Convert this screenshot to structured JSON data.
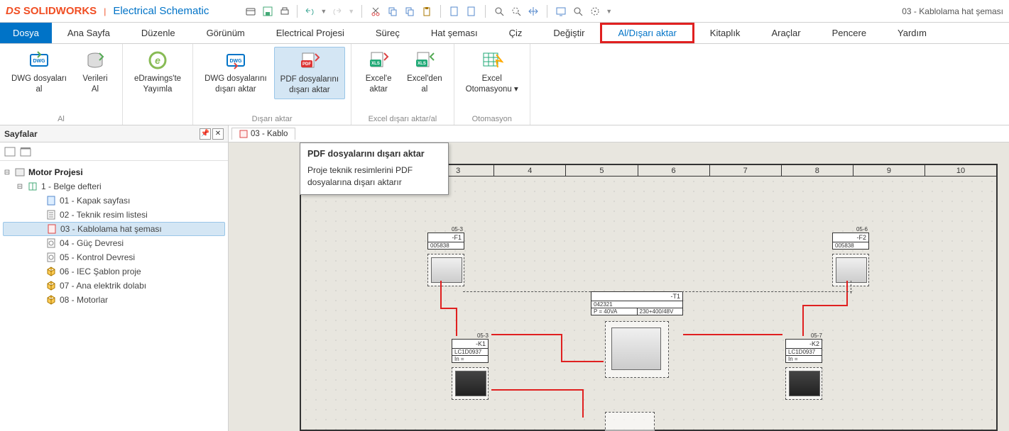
{
  "app": {
    "logo_ds": "DS",
    "logo_sw": "SOLIDWORKS",
    "logo_sub": "Electrical Schematic",
    "document_title": "03 - Kablolama hat şeması"
  },
  "menubar": [
    {
      "label": "Dosya",
      "file": true
    },
    {
      "label": "Ana Sayfa"
    },
    {
      "label": "Düzenle"
    },
    {
      "label": "Görünüm"
    },
    {
      "label": "Electrical Projesi"
    },
    {
      "label": "Süreç"
    },
    {
      "label": "Hat şeması"
    },
    {
      "label": "Çiz"
    },
    {
      "label": "Değiştir"
    },
    {
      "label": "Al/Dışarı aktar",
      "highlighted": true
    },
    {
      "label": "Kitaplık"
    },
    {
      "label": "Araçlar"
    },
    {
      "label": "Pencere"
    },
    {
      "label": "Yardım"
    }
  ],
  "ribbon": {
    "groups": [
      {
        "label": "Al",
        "buttons": [
          {
            "label": "DWG dosyaları\nal",
            "icon": "dwg"
          },
          {
            "label": "Verileri\nAl",
            "icon": "db"
          }
        ]
      },
      {
        "label": "",
        "buttons": [
          {
            "label": "eDrawings'te\nYayımla",
            "icon": "edrawings"
          }
        ]
      },
      {
        "label": "Dışarı aktar",
        "buttons": [
          {
            "label": "DWG dosyalarını\ndışarı aktar",
            "icon": "dwg"
          },
          {
            "label": "PDF dosyalarını\ndışarı aktar",
            "icon": "pdf",
            "active": true
          }
        ]
      },
      {
        "label": "Excel dışarı aktar/al",
        "buttons": [
          {
            "label": "Excel'e\naktar",
            "icon": "xls"
          },
          {
            "label": "Excel'den\nal",
            "icon": "xls"
          }
        ]
      },
      {
        "label": "Otomasyon",
        "buttons": [
          {
            "label": "Excel\nOtomasyonu ▾",
            "icon": "xls-auto"
          }
        ]
      }
    ]
  },
  "tooltip": {
    "title": "PDF dosyalarını dışarı aktar",
    "body": "Proje teknik resimlerini PDF dosyalarına dışarı aktarır"
  },
  "sidebar": {
    "title": "Sayfalar",
    "tree": {
      "root": "Motor Projesi",
      "book": "1 - Belge defteri",
      "pages": [
        {
          "label": "01 - Kapak sayfası",
          "icon": "cover"
        },
        {
          "label": "02 - Teknik resim listesi",
          "icon": "list"
        },
        {
          "label": "03 - Kablolama hat şeması",
          "icon": "wiring",
          "selected": true
        },
        {
          "label": "04 - Güç Devresi",
          "icon": "scheme"
        },
        {
          "label": "05 - Kontrol Devresi",
          "icon": "scheme"
        },
        {
          "label": "06 - IEC Şablon proje",
          "icon": "cube"
        },
        {
          "label": "07 - Ana elektrik dolabı",
          "icon": "cube"
        },
        {
          "label": "08 - Motorlar",
          "icon": "cube"
        }
      ]
    }
  },
  "doc_tab": "03 - Kablo",
  "columns": [
    "3",
    "4",
    "5",
    "6",
    "7",
    "8",
    "9",
    "10"
  ],
  "schematic": {
    "F1": {
      "name": "-F1",
      "code": "005838",
      "ref": "05-3"
    },
    "F2": {
      "name": "-F2",
      "code": "005838",
      "ref": "05-6"
    },
    "K1": {
      "name": "-K1",
      "code": "LC1D0937",
      "in": "In ="
    },
    "K2": {
      "name": "-K2",
      "code": "LC1D0937",
      "in": "In ="
    },
    "T1": {
      "name": "-T1",
      "code": "042321",
      "p": "P = 40VA",
      "v": "230+400/48V"
    }
  }
}
